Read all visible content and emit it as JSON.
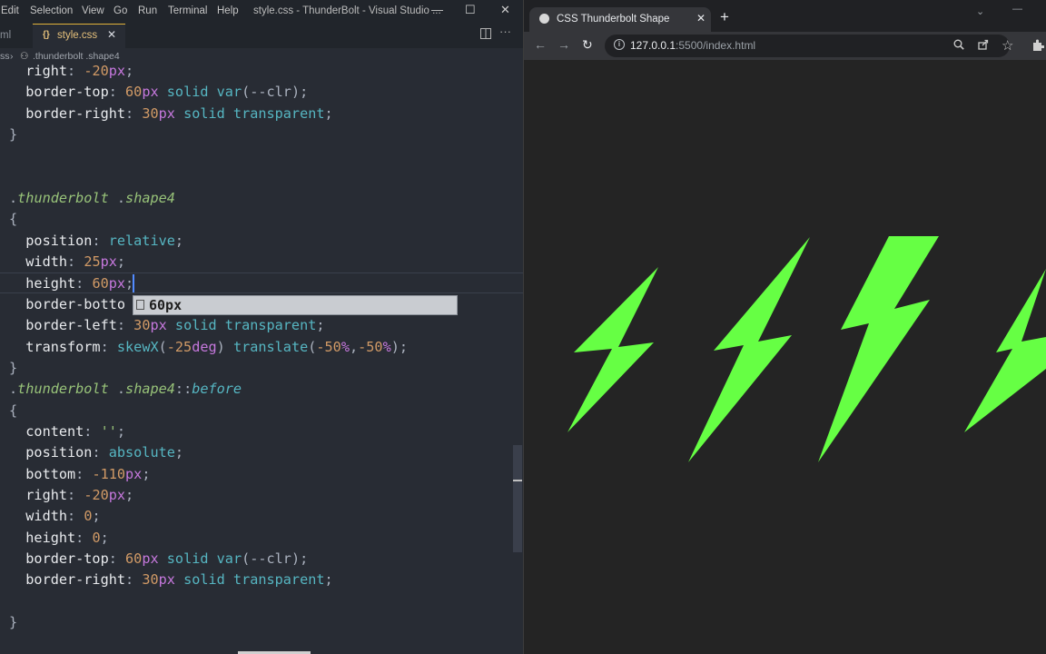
{
  "vscode": {
    "menu": [
      "Edit",
      "Selection",
      "View",
      "Go",
      "Run",
      "Terminal",
      "Help"
    ],
    "window_title": "style.css - ThunderBolt - Visual Studio ...",
    "window_controls": {
      "minimize": "—",
      "maximize": "☐",
      "close": "✕"
    },
    "tabs": {
      "prev_tab": "ml",
      "active_icon": "{}",
      "active_tab": "style.css",
      "close": "✕",
      "split_icon": "split-editor-icon",
      "more_icon": "more-actions-icon"
    },
    "breadcrumb": {
      "prefix": "ss",
      "sep": "›",
      "symbol_icon": "⚇",
      "item": ".thunderbolt .shape4"
    },
    "editor": {
      "lines": [
        [
          [
            "t-prop",
            "  right"
          ],
          [
            "t-punc",
            ": "
          ],
          [
            "t-num",
            "-20"
          ],
          [
            "t-unit",
            "px"
          ],
          [
            "t-punc",
            ";"
          ]
        ],
        [
          [
            "t-prop",
            "  border-top"
          ],
          [
            "t-punc",
            ": "
          ],
          [
            "t-num",
            "60"
          ],
          [
            "t-unit",
            "px"
          ],
          [
            "t-punc",
            " "
          ],
          [
            "t-val",
            "solid"
          ],
          [
            "t-punc",
            " "
          ],
          [
            "t-val",
            "var"
          ],
          [
            "t-punc",
            "(--clr);"
          ]
        ],
        [
          [
            "t-prop",
            "  border-right"
          ],
          [
            "t-punc",
            ": "
          ],
          [
            "t-num",
            "30"
          ],
          [
            "t-unit",
            "px"
          ],
          [
            "t-punc",
            " "
          ],
          [
            "t-val",
            "solid transparent"
          ],
          [
            "t-punc",
            ";"
          ]
        ],
        [
          [
            "t-brace",
            "}"
          ]
        ],
        [],
        [],
        [
          [
            "t-dot",
            "."
          ],
          [
            "t-sel",
            "thunderbolt"
          ],
          [
            "t-punc",
            " ."
          ],
          [
            "t-sel",
            "shape4"
          ]
        ],
        [
          [
            "t-brace",
            "{"
          ]
        ],
        [
          [
            "t-prop",
            "  position"
          ],
          [
            "t-punc",
            ": "
          ],
          [
            "t-val",
            "relative"
          ],
          [
            "t-punc",
            ";"
          ]
        ],
        [
          [
            "t-prop",
            "  width"
          ],
          [
            "t-punc",
            ": "
          ],
          [
            "t-num",
            "25"
          ],
          [
            "t-unit",
            "px"
          ],
          [
            "t-punc",
            ";"
          ]
        ],
        [
          [
            "t-prop",
            "  height"
          ],
          [
            "t-punc",
            ": "
          ],
          [
            "t-num",
            "60"
          ],
          [
            "t-unit",
            "px"
          ],
          [
            "t-punc",
            ";"
          ]
        ],
        [
          [
            "t-prop",
            "  border-botto"
          ]
        ],
        [
          [
            "t-prop",
            "  border-left"
          ],
          [
            "t-punc",
            ": "
          ],
          [
            "t-num",
            "30"
          ],
          [
            "t-unit",
            "px"
          ],
          [
            "t-punc",
            " "
          ],
          [
            "t-val",
            "solid transparent"
          ],
          [
            "t-punc",
            ";"
          ]
        ],
        [
          [
            "t-prop",
            "  transform"
          ],
          [
            "t-punc",
            ": "
          ],
          [
            "t-val",
            "skewX"
          ],
          [
            "t-punc",
            "("
          ],
          [
            "t-num",
            "-25"
          ],
          [
            "t-unit",
            "deg"
          ],
          [
            "t-punc",
            ") "
          ],
          [
            "t-val",
            "translate"
          ],
          [
            "t-punc",
            "("
          ],
          [
            "t-num",
            "-50"
          ],
          [
            "t-unit",
            "%"
          ],
          [
            "t-punc",
            ","
          ],
          [
            "t-num",
            "-50"
          ],
          [
            "t-unit",
            "%"
          ],
          [
            "t-punc",
            ");"
          ]
        ],
        [
          [
            "t-brace",
            "}"
          ]
        ],
        [
          [
            "t-dot",
            "."
          ],
          [
            "t-sel",
            "thunderbolt"
          ],
          [
            "t-punc",
            " ."
          ],
          [
            "t-sel",
            "shape4"
          ],
          [
            "t-punc",
            "::"
          ],
          [
            "t-pseudo",
            "before"
          ]
        ],
        [
          [
            "t-brace",
            "{"
          ]
        ],
        [
          [
            "t-prop",
            "  content"
          ],
          [
            "t-punc",
            ": "
          ],
          [
            "t-str",
            "''"
          ],
          [
            "t-punc",
            ";"
          ]
        ],
        [
          [
            "t-prop",
            "  position"
          ],
          [
            "t-punc",
            ": "
          ],
          [
            "t-val",
            "absolute"
          ],
          [
            "t-punc",
            ";"
          ]
        ],
        [
          [
            "t-prop",
            "  bottom"
          ],
          [
            "t-punc",
            ": "
          ],
          [
            "t-num",
            "-110"
          ],
          [
            "t-unit",
            "px"
          ],
          [
            "t-punc",
            ";"
          ]
        ],
        [
          [
            "t-prop",
            "  right"
          ],
          [
            "t-punc",
            ": "
          ],
          [
            "t-num",
            "-20"
          ],
          [
            "t-unit",
            "px"
          ],
          [
            "t-punc",
            ";"
          ]
        ],
        [
          [
            "t-prop",
            "  width"
          ],
          [
            "t-punc",
            ": "
          ],
          [
            "t-num",
            "0"
          ],
          [
            "t-punc",
            ";"
          ]
        ],
        [
          [
            "t-prop",
            "  height"
          ],
          [
            "t-punc",
            ": "
          ],
          [
            "t-num",
            "0"
          ],
          [
            "t-punc",
            ";"
          ]
        ],
        [
          [
            "t-prop",
            "  border-top"
          ],
          [
            "t-punc",
            ": "
          ],
          [
            "t-num",
            "60"
          ],
          [
            "t-unit",
            "px"
          ],
          [
            "t-punc",
            " "
          ],
          [
            "t-val",
            "solid"
          ],
          [
            "t-punc",
            " "
          ],
          [
            "t-val",
            "var"
          ],
          [
            "t-punc",
            "(--clr);"
          ]
        ],
        [
          [
            "t-prop",
            "  border-right"
          ],
          [
            "t-punc",
            ": "
          ],
          [
            "t-num",
            "30"
          ],
          [
            "t-unit",
            "px"
          ],
          [
            "t-punc",
            " "
          ],
          [
            "t-val",
            "solid transparent"
          ],
          [
            "t-punc",
            ";"
          ]
        ],
        [],
        [
          [
            "t-brace",
            "}"
          ]
        ]
      ],
      "suggestion": "60px"
    }
  },
  "browser": {
    "tab_title": "CSS Thunderbolt Shape",
    "tab_close": "✕",
    "new_tab": "+",
    "window_controls": {
      "minimize": "⌄",
      "restore": "—"
    },
    "nav": {
      "back": "←",
      "forward": "→",
      "reload": "↻"
    },
    "url_host": "127.0.0.1",
    "url_rest": ":5500/index.html",
    "toolbar_icons": [
      "zoom-icon",
      "share-icon",
      "bookmark-star-icon",
      "extensions-icon"
    ],
    "bolt_color": "#66ff44",
    "bolt_count": 4
  },
  "colors": {
    "editor_bg": "#282c34",
    "titlebar_bg": "#21252b",
    "page_bg": "#242424",
    "accent_tab": "#e0b13a"
  }
}
